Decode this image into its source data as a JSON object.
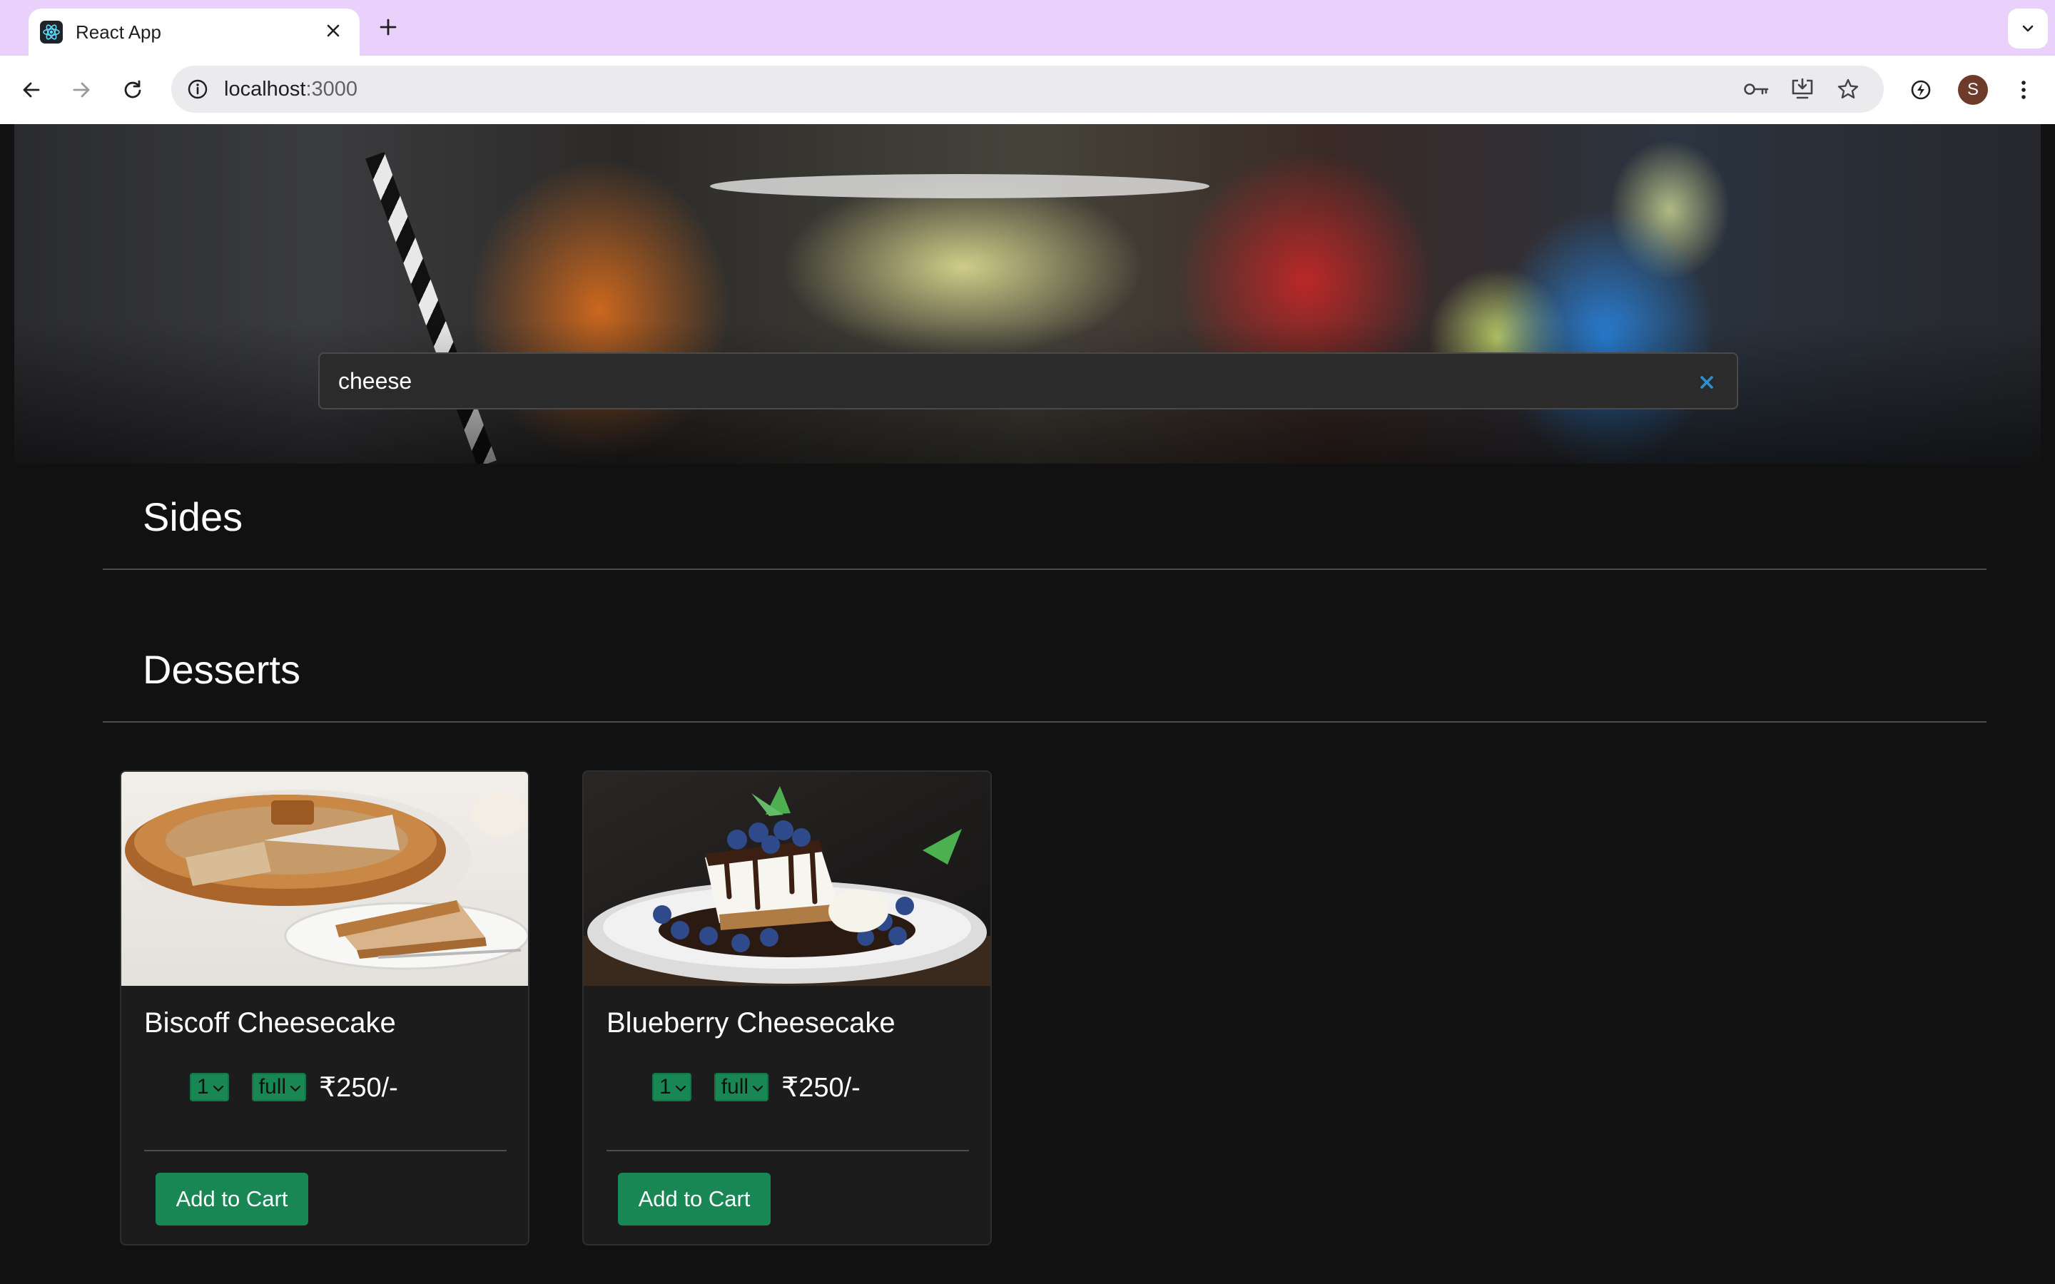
{
  "browser": {
    "tab_title": "React App",
    "url_host": "localhost",
    "url_port": ":3000",
    "avatar_initial": "S"
  },
  "search": {
    "value": "cheese"
  },
  "sections": [
    {
      "title": "Sides"
    },
    {
      "title": "Desserts"
    }
  ],
  "items": [
    {
      "name": "Biscoff Cheesecake",
      "qty": "1",
      "size": "full",
      "price": "₹250/-",
      "button": "Add to Cart"
    },
    {
      "name": "Blueberry Cheesecake",
      "qty": "1",
      "size": "full",
      "price": "₹250/-",
      "button": "Add to Cart"
    }
  ],
  "colors": {
    "accent": "#198754",
    "tab_strip": "#ead1fb",
    "page_bg": "#111111",
    "card_bg": "#1c1c1c"
  }
}
